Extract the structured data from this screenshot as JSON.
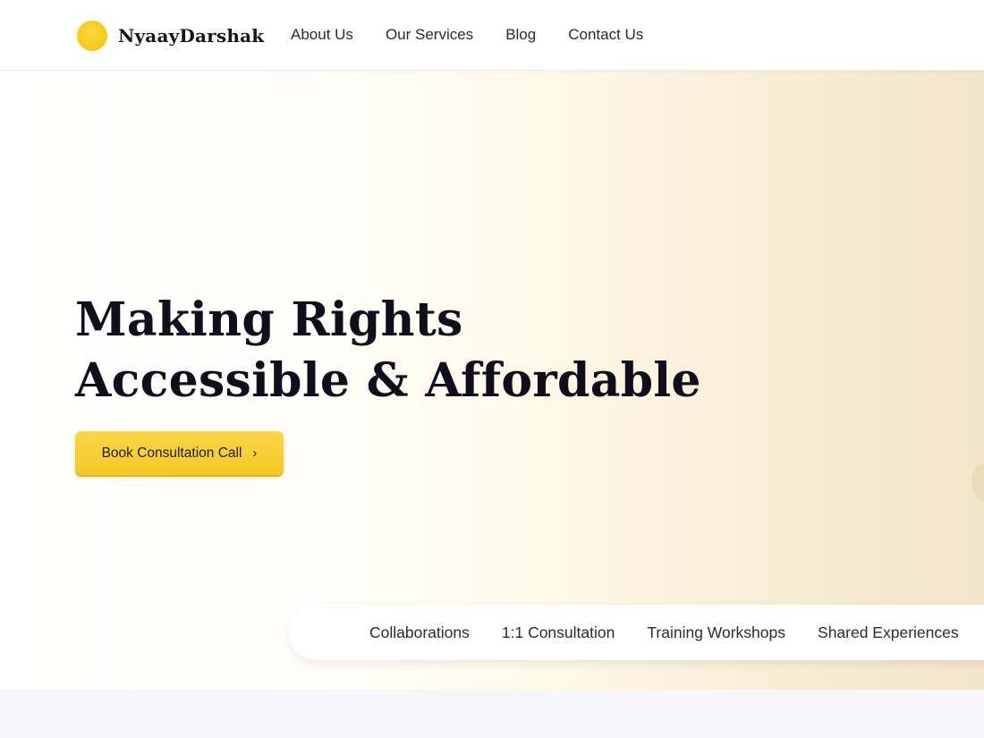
{
  "brand": {
    "name": "NyaayDarshak",
    "logo_color": "#f7c917"
  },
  "nav": {
    "items": [
      "About Us",
      "Our Services",
      "Blog",
      "Contact Us"
    ]
  },
  "hero": {
    "title_line1": "Making Rights",
    "title_line2": "Accessible & Affordable",
    "cta_label": "Book Consultation Call",
    "cta_icon": "chevron-right-icon",
    "accent_color": "#f7c917"
  },
  "tabs": [
    "Collaborations",
    "1:1 Consultation",
    "Training Workshops",
    "Shared Experiences"
  ]
}
